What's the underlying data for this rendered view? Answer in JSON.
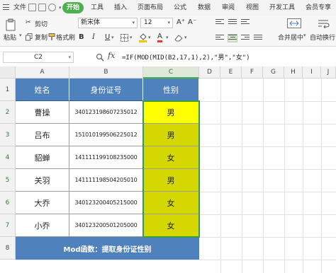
{
  "menubar": {
    "file": "文件",
    "tabs": [
      "开始",
      "工具",
      "插入",
      "页面布局",
      "公式",
      "数据",
      "审阅",
      "视图",
      "开发工具",
      "会员专享"
    ],
    "active_tab": "开始"
  },
  "ribbon": {
    "paste": "粘贴",
    "cut": "剪切",
    "copy": "复制",
    "format_painter": "格式刷",
    "font_name": "新宋体",
    "font_size": "12",
    "bold": "B",
    "italic": "I",
    "underline": "U",
    "merge_center": "合并居中",
    "auto_wrap": "自动换行",
    "font_color_a": "A",
    "grow_font": "A⁺",
    "shrink_font": "A⁻"
  },
  "formula_bar": {
    "name_box": "C2",
    "fx": "fx",
    "formula": "=IF(MOD(MID(B2,17,1),2),\"男\",\"女\")"
  },
  "sheet": {
    "columns": [
      "A",
      "B",
      "C",
      "D",
      "E",
      "F",
      "G",
      "H",
      "I",
      "J"
    ],
    "rows": [
      "1",
      "2",
      "3",
      "4",
      "5",
      "6",
      "7",
      "8"
    ],
    "header": {
      "name": "姓名",
      "id": "身份证号",
      "gender": "性别"
    },
    "records": [
      {
        "name": "曹操",
        "id": "340123198607235012",
        "gender": "男"
      },
      {
        "name": "吕布",
        "id": "151010199506225012",
        "gender": "男"
      },
      {
        "name": "貂蝉",
        "id": "141111199108235000",
        "gender": "女"
      },
      {
        "name": "关羽",
        "id": "141111198504205010",
        "gender": "男"
      },
      {
        "name": "大乔",
        "id": "340123200405215000",
        "gender": "女"
      },
      {
        "name": "小乔",
        "id": "340123200501205000",
        "gender": "女"
      }
    ],
    "footer": "Mod函数：提取身份证性别",
    "colors": {
      "header_bg": "#4f81bd",
      "active_cell_bg": "#ffff00",
      "filled_cell_bg": "#d4d800",
      "selection_border": "#3d9a3d"
    }
  }
}
